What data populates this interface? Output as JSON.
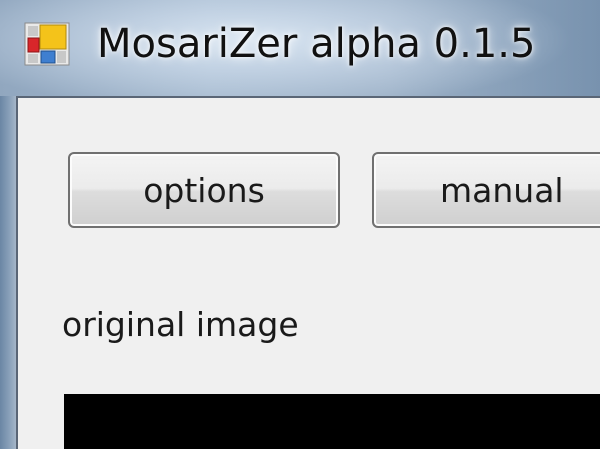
{
  "window": {
    "title": "MosariZer alpha 0.1.5",
    "icon": "mosaic-app-icon"
  },
  "toolbar": {
    "options_label": "options",
    "manual_label": "manual"
  },
  "main": {
    "original_image_label": "original image"
  },
  "colors": {
    "client_background": "#f0f0f0",
    "image_preview": "#000000",
    "icon_red": "#d8262a",
    "icon_yellow": "#f4c31a",
    "icon_blue": "#3f7fd0",
    "icon_gray": "#c8c8c8"
  }
}
